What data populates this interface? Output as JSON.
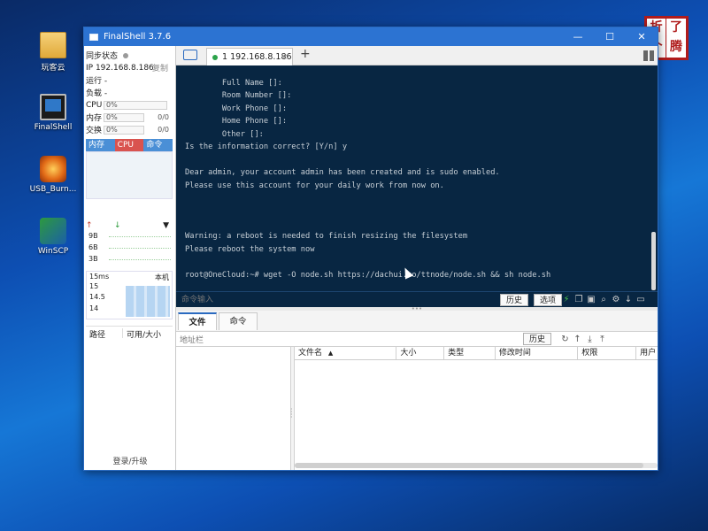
{
  "desktop": {
    "icons": [
      {
        "label": "玩客云"
      },
      {
        "label": "FinalShell"
      },
      {
        "label": "USB_Burn..."
      },
      {
        "label": "WinSCP"
      }
    ],
    "stamp_chars": [
      "折",
      "了",
      "个",
      "腾"
    ]
  },
  "window": {
    "title": "FinalShell 3.7.6",
    "controls": {
      "minimize": "—",
      "maximize": "☐",
      "close": "✕"
    }
  },
  "sidebar": {
    "sync_status": "同步状态",
    "ip": "IP 192.168.8.186",
    "copy": "复制",
    "running": "运行 -",
    "load": "负载 -",
    "metrics": [
      {
        "label": "CPU",
        "value": "0%",
        "ratio": "",
        "percent": 0
      },
      {
        "label": "内存",
        "value": "0%",
        "ratio": "0/0",
        "percent": 0
      },
      {
        "label": "交换",
        "value": "0%",
        "ratio": "0/0",
        "percent": 0
      }
    ],
    "process_tabs": [
      "内存",
      "CPU",
      "命令"
    ],
    "net_scale": [
      "9B",
      "6B",
      "3B"
    ],
    "ping": {
      "label": "15ms",
      "host": "本机",
      "scale": [
        "15",
        "14.5",
        "14"
      ]
    },
    "drive_columns": [
      "路径",
      "可用/大小"
    ],
    "upgrade": "登录/升级"
  },
  "tabs": {
    "session_label": "1 192.168.8.186",
    "close": "×",
    "add": "+"
  },
  "terminal": {
    "lines": [
      "        Full Name []:",
      "        Room Number []:",
      "        Work Phone []:",
      "        Home Phone []:",
      "        Other []:",
      "Is the information correct? [Y/n] y",
      "",
      "Dear admin, your account admin has been created and is sudo enabled.",
      "Please use this account for your daily work from now on.",
      "",
      "",
      "",
      "Warning: a reboot is needed to finish resizing the filesystem",
      "Please reboot the system now",
      "",
      "root@OneCloud:~# wget -O node.sh https://dachui.co/ttnode/node.sh && sh node.sh"
    ]
  },
  "cmdbar": {
    "placeholder": "命令输入",
    "history": "历史",
    "options": "选项"
  },
  "files": {
    "tabs": [
      "文件",
      "命令"
    ],
    "address_placeholder": "地址栏",
    "history": "历史",
    "columns": [
      "文件名",
      "大小",
      "类型",
      "修改时间",
      "权限",
      "用户"
    ]
  },
  "colors": {
    "terminal_bg": "#082642",
    "accent": "#2c73d2",
    "process_tab_active": "#d9534f"
  }
}
